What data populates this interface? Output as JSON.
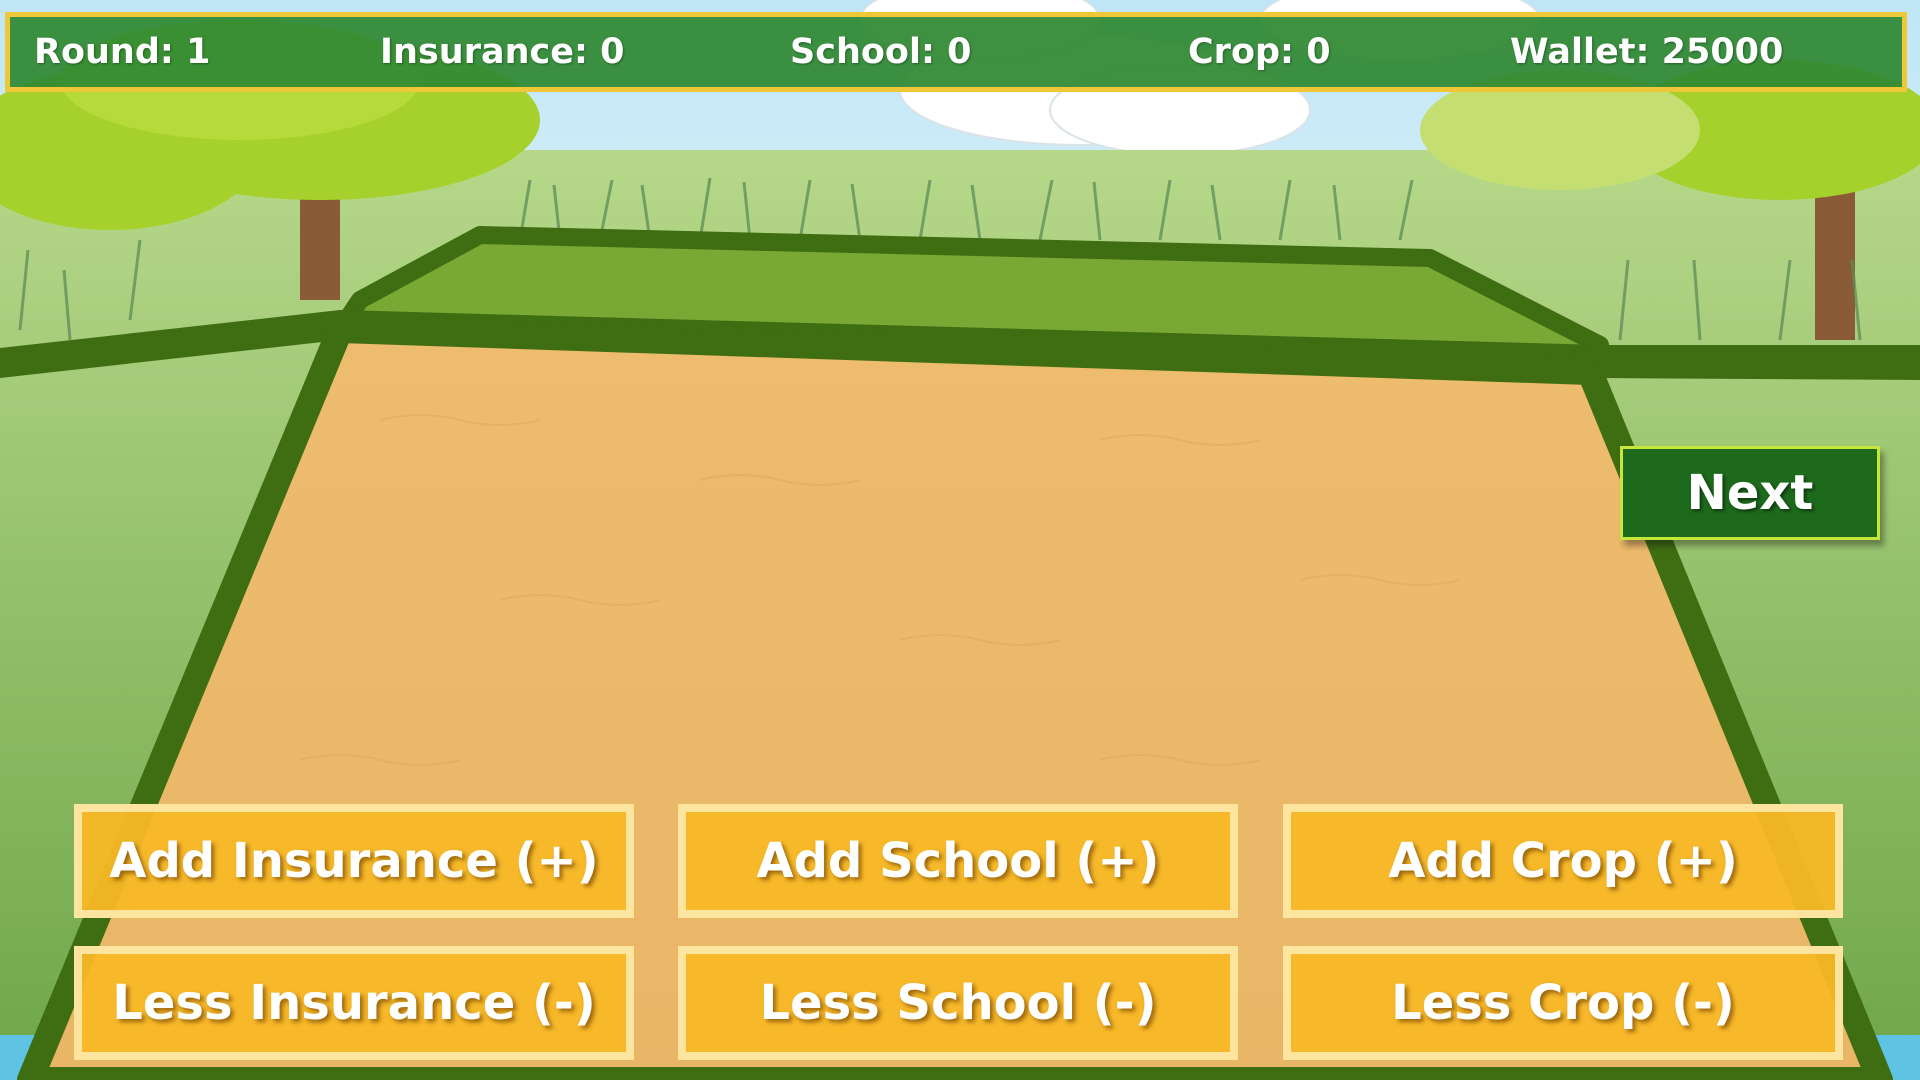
{
  "hud": {
    "round": "Round: 1",
    "insurance": "Insurance: 0",
    "school": "School: 0",
    "crop": "Crop: 0",
    "wallet": "Wallet: 25000"
  },
  "buttons": {
    "next": "Next",
    "add_insurance": "Add Insurance (+)",
    "add_school": "Add School (+)",
    "add_crop": "Add Crop (+)",
    "less_insurance": "Less Insurance (-)",
    "less_school": "Less School (-)",
    "less_crop": "Less Crop (-)"
  },
  "colors": {
    "hud_bg": "#2f8932",
    "hud_border": "#efc83a",
    "next_bg": "#1e6a1c",
    "action_bg": "#f8b826",
    "field_sand": "#eab86a",
    "field_border": "#3f6d12"
  }
}
